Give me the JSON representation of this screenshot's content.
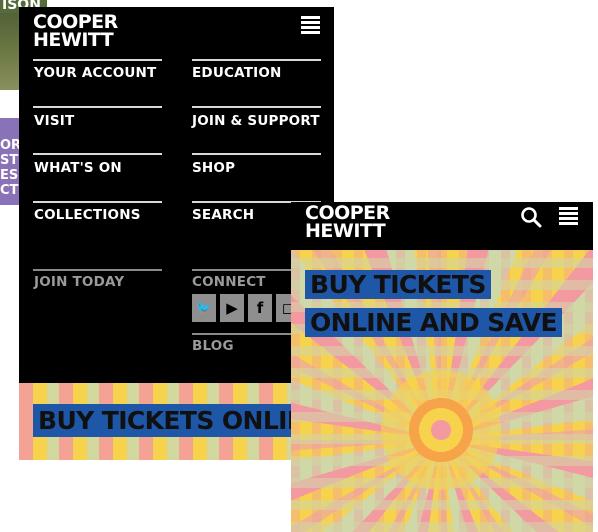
{
  "background_page": {
    "partial_text_top": "ISON",
    "partial_text_left": [
      "ORS",
      "ST",
      "ESI",
      "CT"
    ]
  },
  "menu_screen": {
    "logo": [
      "COOPER",
      "HEWITT"
    ],
    "nav_left": [
      "YOUR ACCOUNT",
      "VISIT",
      "WHAT'S ON",
      "COLLECTIONS"
    ],
    "nav_right": [
      "EDUCATION",
      "JOIN & SUPPORT",
      "SHOP",
      "SEARCH"
    ],
    "join_today": "JOIN TODAY",
    "connect": "CONNECT",
    "blog": "BLOG",
    "social_icons": [
      "twitter-icon",
      "youtube-icon",
      "facebook-icon",
      "instagram-icon"
    ],
    "banner_text": "BUY TICKETS ONLINE AND SAVE"
  },
  "home_screen": {
    "logo": [
      "COOPER",
      "HEWITT"
    ],
    "banner_text": "BUY TICKETS ONLINE AND SAVE"
  },
  "colors": {
    "header_bg": "#000000",
    "banner_blue": "#1f57a8",
    "pattern_yellow": "#f6d24d",
    "pattern_pink": "#f39aa0",
    "pattern_sage": "#cfd8a6"
  }
}
